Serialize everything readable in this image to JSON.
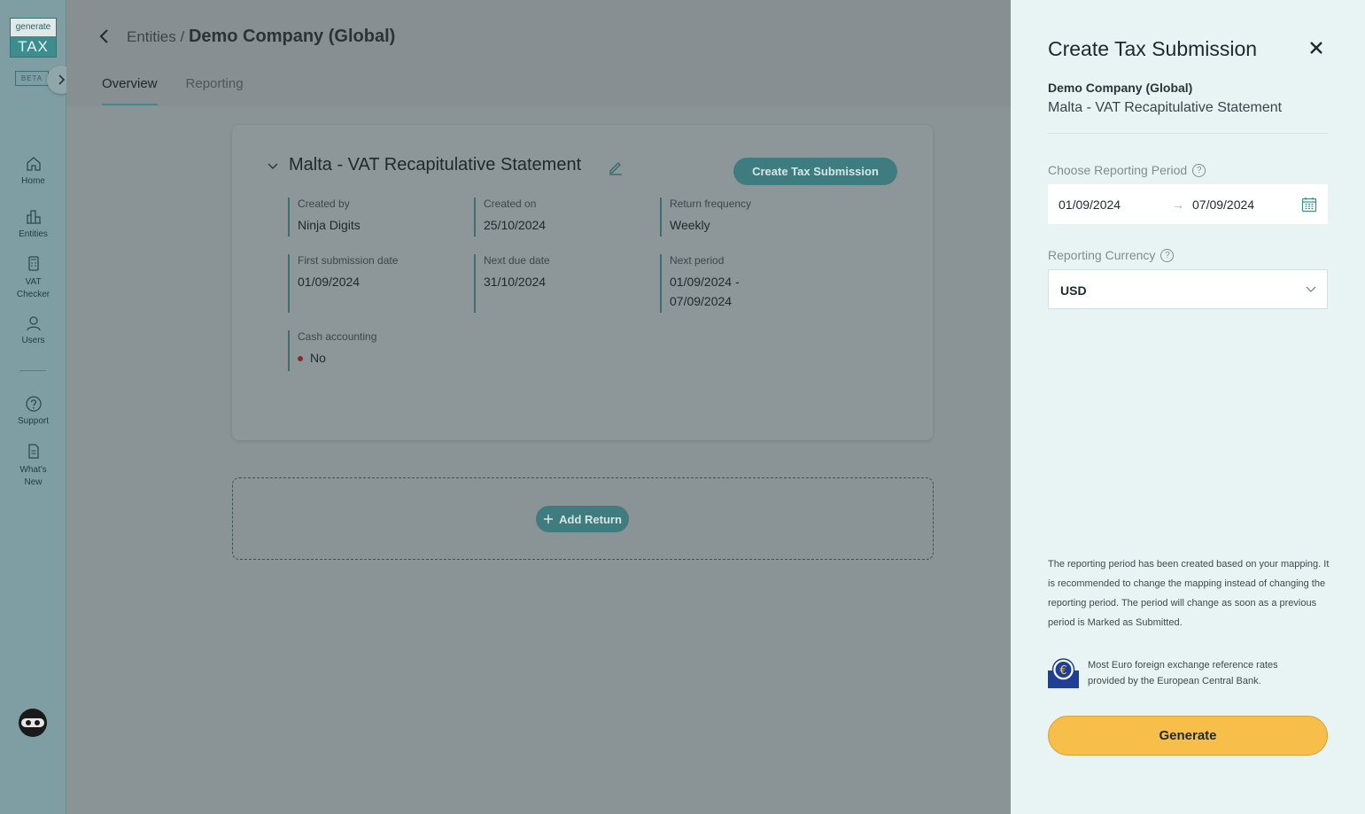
{
  "sidebar": {
    "logo_top": "generate",
    "logo_bottom": "TAX",
    "beta_label": "BETA",
    "nav": [
      {
        "label": "Home"
      },
      {
        "label": "Entities"
      },
      {
        "label": "VAT Checker"
      },
      {
        "label": "Users"
      },
      {
        "label": "Support"
      },
      {
        "label": "What's New"
      }
    ]
  },
  "header": {
    "breadcrumb_parent": "Entities /",
    "breadcrumb_current": "Demo Company (Global)",
    "tabs": [
      {
        "label": "Overview",
        "active": true
      },
      {
        "label": "Reporting",
        "active": false
      }
    ]
  },
  "card": {
    "title": "Malta - VAT Recapitulative Statement",
    "create_button": "Create Tax Submission",
    "fields": [
      {
        "label": "Created by",
        "value": "Ninja Digits"
      },
      {
        "label": "Created on",
        "value": "25/10/2024"
      },
      {
        "label": "Return frequency",
        "value": "Weekly"
      },
      {
        "label": "First submission date",
        "value": "01/09/2024"
      },
      {
        "label": "Next due date",
        "value": "31/10/2024"
      },
      {
        "label": "Next period",
        "value": "01/09/2024 -",
        "value2": "07/09/2024"
      },
      {
        "label": "Cash accounting",
        "value": "No"
      }
    ]
  },
  "add_return": {
    "label": "Add Return"
  },
  "drawer": {
    "title": "Create Tax Submission",
    "company": "Demo Company (Global)",
    "statement": "Malta - VAT Recapitulative Statement",
    "period_label": "Choose Reporting Period",
    "period_start": "01/09/2024",
    "period_arrow": "→",
    "period_end": "07/09/2024",
    "currency_label": "Reporting Currency",
    "currency_value": "USD",
    "help_glyph": "?",
    "note": "The reporting period has been created based on your mapping. It is recommended to change the mapping instead of changing the reporting period. The period will change as soon as a previous period is Marked as Submitted.",
    "ecb_text": "Most Euro foreign exchange reference rates provided by the European Central Bank.",
    "generate_button": "Generate"
  },
  "colors": {
    "accent": "#3f7c7f",
    "generate": "#f8be4a",
    "drawer_bg": "#e8f4f4"
  }
}
